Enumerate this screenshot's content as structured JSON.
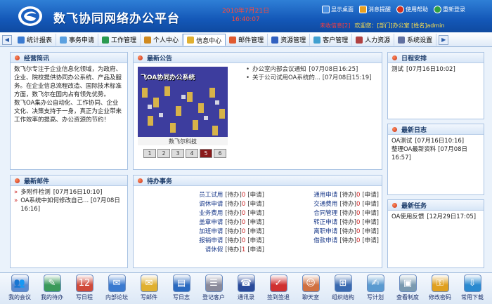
{
  "header": {
    "title": "数飞协同网络办公平台",
    "date": "2010年7月21日",
    "time": "16:40:07",
    "links": [
      {
        "label": "显示桌面",
        "icon": "desktop-icon",
        "color": "#4a8fe0"
      },
      {
        "label": "消息提醒",
        "icon": "message-icon",
        "color": "#e8a020"
      },
      {
        "label": "使用帮助",
        "icon": "help-icon",
        "color": "#d03020"
      },
      {
        "label": "重新登录",
        "icon": "relogin-icon",
        "color": "#30a040"
      }
    ],
    "msg_label": "未收信息[2]",
    "welcome": "欢迎您：[部门]办公室 [姓名]admin"
  },
  "nav": {
    "items": [
      {
        "label": "统计报表",
        "icon": "report-icon",
        "color": "#3a7ad0"
      },
      {
        "label": "事务申请",
        "icon": "apply-icon",
        "color": "#5aa0e0"
      },
      {
        "label": "工作管理",
        "icon": "work-icon",
        "color": "#2a9a50"
      },
      {
        "label": "个人中心",
        "icon": "person-icon",
        "color": "#d08a20"
      },
      {
        "label": "信息中心",
        "icon": "info-icon",
        "color": "#e0b030"
      },
      {
        "label": "邮件管理",
        "icon": "mail-icon",
        "color": "#e05a30"
      },
      {
        "label": "资源管理",
        "icon": "resource-icon",
        "color": "#3060c0"
      },
      {
        "label": "客户管理",
        "icon": "customer-icon",
        "color": "#40a0d0"
      },
      {
        "label": "人力资源",
        "icon": "hr-icon",
        "color": "#b04040"
      },
      {
        "label": "系统设置",
        "icon": "settings-icon",
        "color": "#6070a0"
      }
    ],
    "active": "信息中心"
  },
  "profile": {
    "title": "经营简讯",
    "text1": "数飞尔专注于企业信息化领域，为政府、企业、院校提供协同办公系统、产品及服务。在企业信息流程改造、国际技术标准方面，数飞尔在国内占有领先优势。",
    "text2": "数飞OA集办公自动化、工作协同、企业文化、决策支持于一身，真正为企业带来工作效率的提高、办公资源的节约！"
  },
  "notice": {
    "title": "最新公告",
    "image_caption": "数飞尔科技",
    "image_text": "飞OA协同办公系统",
    "tabs": [
      "1",
      "2",
      "3",
      "4",
      "5",
      "6"
    ],
    "items": [
      {
        "text": "办公室内部会议通知",
        "date": "[07月08日16:25]"
      },
      {
        "text": "关于公司试用OA系统的...",
        "date": "[07月08日15:19]"
      }
    ]
  },
  "schedule": {
    "title": "日程安排",
    "items": [
      {
        "text": "测试",
        "date": "[07月16日10:02]"
      }
    ]
  },
  "mail": {
    "title": "最新邮件",
    "items": [
      {
        "text": "多附件检测",
        "date": "[07月16日10:10]"
      },
      {
        "text": "OA系统中如何修改自己...",
        "date": "[07月08日16:16]"
      }
    ]
  },
  "log": {
    "title": "最新日志",
    "items": [
      {
        "text": "OA测试",
        "date": "[07月16日10:16]"
      },
      {
        "text": "整理OA最新资料",
        "date": "[07月08日16:57]"
      }
    ]
  },
  "todo": {
    "title": "待办事务",
    "status": "[待办]",
    "apply": "[申请]",
    "left": [
      {
        "name": "员工试用",
        "count": "0"
      },
      {
        "name": "调休申请",
        "count": "0"
      },
      {
        "name": "业务费用",
        "count": "0"
      },
      {
        "name": "盖章申请",
        "count": "0"
      },
      {
        "name": "加班申请",
        "count": "0"
      },
      {
        "name": "报销申请",
        "count": "0"
      },
      {
        "name": "请休假",
        "count": "1"
      }
    ],
    "right": [
      {
        "name": "通用申请",
        "count": "0"
      },
      {
        "name": "交通费用",
        "count": "0"
      },
      {
        "name": "合同管理",
        "count": "0"
      },
      {
        "name": "转正申请",
        "count": "0"
      },
      {
        "name": "离职申请",
        "count": "0"
      },
      {
        "name": "借款申请",
        "count": "0"
      }
    ]
  },
  "tasks": {
    "title": "最新任务",
    "items": [
      {
        "text": "OA使用反馈",
        "date": "[12月29日17:05]"
      }
    ]
  },
  "bottom": [
    {
      "label": "我的会议",
      "icon": "meeting-icon",
      "color": "#5a8ad0"
    },
    {
      "label": "我的待办",
      "icon": "todo-icon",
      "color": "#3a9a5a"
    },
    {
      "label": "写日程",
      "icon": "calendar-icon",
      "color": "#d04a3a"
    },
    {
      "label": "内部论坛",
      "icon": "forum-icon",
      "color": "#3a7ad0"
    },
    {
      "label": "写邮件",
      "icon": "mail-icon",
      "color": "#e0b030"
    },
    {
      "label": "写日志",
      "icon": "book-icon",
      "color": "#2a6ac0"
    },
    {
      "label": "登记客户",
      "icon": "customer-icon",
      "color": "#8a8a9a"
    },
    {
      "label": "通讯录",
      "icon": "phone-icon",
      "color": "#2a4a9a"
    },
    {
      "label": "签到签退",
      "icon": "signin-icon",
      "color": "#d03030"
    },
    {
      "label": "聊天室",
      "icon": "chat-icon",
      "color": "#d07040"
    },
    {
      "label": "组织结构",
      "icon": "org-icon",
      "color": "#3a6ab0"
    },
    {
      "label": "写计划",
      "icon": "plan-icon",
      "color": "#5a9ad0"
    },
    {
      "label": "查看制度",
      "icon": "rule-icon",
      "color": "#7a9ab0"
    },
    {
      "label": "修改密码",
      "icon": "key-icon",
      "color": "#e0a020"
    },
    {
      "label": "常用下载",
      "icon": "download-icon",
      "color": "#2a8ad0"
    }
  ]
}
